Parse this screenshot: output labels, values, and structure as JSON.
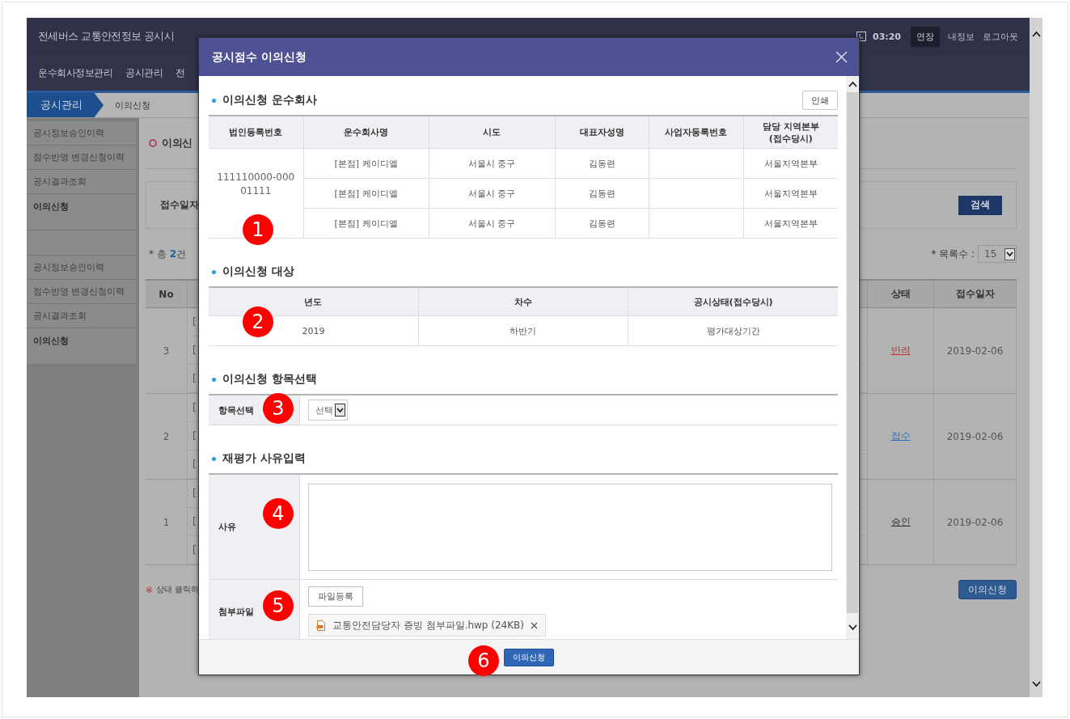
{
  "app": {
    "title": "전세버스 교통안전정보 공시시",
    "time": "03:20",
    "extend": "연장",
    "links": [
      "내정보",
      "로그아웃"
    ],
    "nav": [
      "운수회사정보관리",
      "공시관리",
      "전"
    ],
    "breadcrumb": [
      "공시관리",
      "이의신청"
    ],
    "sidebar_groups": [
      [
        {
          "label": "공시정보승인이력",
          "selected": false
        },
        {
          "label": "점수반영 변경신청이력",
          "selected": false
        },
        {
          "label": "공시결과조회",
          "selected": false
        },
        {
          "label": "이의신청",
          "selected": true
        }
      ],
      [
        {
          "label": "공시정보승인이력",
          "selected": false
        },
        {
          "label": "점수반영 변경신청이력",
          "selected": false
        },
        {
          "label": "공시결과조회",
          "selected": false
        },
        {
          "label": "이의신청",
          "selected": true
        }
      ]
    ],
    "page_title": "이의신",
    "search": {
      "label": "접수일자",
      "button": "검색"
    },
    "total": "* 총 **2**건",
    "page_size": {
      "label": "* 목록수 :",
      "value": "15"
    },
    "table": {
      "columns": [
        "No",
        "상태",
        "접수일자"
      ],
      "rows": [
        {
          "no": "3",
          "fragments": [
            "[",
            "[",
            "["
          ],
          "status": "반려",
          "color": "#c0392b",
          "date": "2019-02-06"
        },
        {
          "no": "2",
          "fragments": [
            "[",
            "[",
            "["
          ],
          "status": "접수",
          "color": "#2f6fc4",
          "date": "2019-02-06"
        },
        {
          "no": "1",
          "fragments": [
            "[",
            "[",
            "["
          ],
          "status": "승인",
          "color": "#333333",
          "date": "2019-02-06"
        }
      ]
    },
    "note_mark": "※",
    "note": "상태 클릭하",
    "apply_button": "이의신청"
  },
  "modal": {
    "title": "공시점수 이의신청",
    "company": {
      "title": "이의신청 운수회사",
      "print": "인쇄",
      "columns": [
        "법인등록번호",
        "운수회사명",
        "시도",
        "대표자성명",
        "사업자등록번호",
        "담당 지역본부 (접수당시)"
      ],
      "reg_no": "111110000-00001111",
      "rows": [
        {
          "name": "[본점] 케이디엘",
          "region": "서울시 중구",
          "ceo": "김동련",
          "office": "서울지역본부"
        },
        {
          "name": "[본점] 케이디엘",
          "region": "서울시 중구",
          "ceo": "김동련",
          "office": "서울지역본부"
        },
        {
          "name": "[본점] 케이디엘",
          "region": "서울시 중구",
          "ceo": "김동련",
          "office": "서울지역본부"
        }
      ]
    },
    "target": {
      "title": "이의신청 대상",
      "columns": [
        "년도",
        "차수",
        "공시상태(접수당시)"
      ],
      "values": [
        "2019",
        "하반기",
        "평가대상기간"
      ]
    },
    "item": {
      "title": "이의신청 항목선택",
      "label": "항목선택",
      "select": "선택"
    },
    "reason": {
      "title": "재평가 사유입력",
      "label": "사유",
      "file_label": "첨부파일",
      "upload": "파일등록",
      "file": "교통안전담당자 증빙 첨부파일.hwp (24KB)"
    },
    "submit": "이의신청",
    "annotations": [
      "1",
      "2",
      "3",
      "4",
      "5",
      "6"
    ]
  }
}
